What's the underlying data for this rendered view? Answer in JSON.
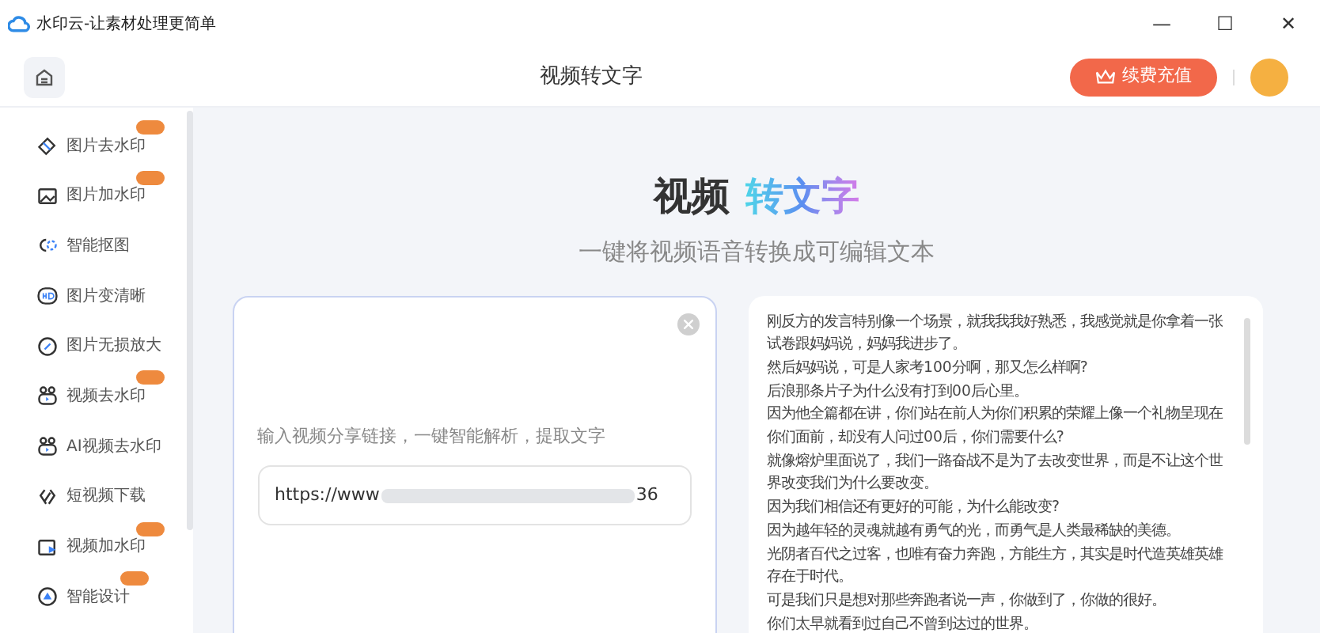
{
  "window": {
    "title": "水印云-让素材处理更简单",
    "controls": [
      "—",
      "☐",
      "✕"
    ]
  },
  "header": {
    "title": "视频转文字",
    "recharge": "续费充值"
  },
  "sidebar": {
    "items": [
      {
        "label": "图片去水印",
        "kind": "eraser",
        "badge": true
      },
      {
        "label": "图片加水印",
        "kind": "image",
        "badge": true
      },
      {
        "label": "智能抠图",
        "kind": "cutout",
        "badge": false
      },
      {
        "label": "图片变清晰",
        "kind": "hd",
        "badge": false
      },
      {
        "label": "图片无损放大",
        "kind": "zoom",
        "badge": false
      },
      {
        "label": "视频去水印",
        "kind": "video",
        "badge": true
      },
      {
        "label": "AI视频去水印",
        "kind": "video",
        "badge": false
      },
      {
        "label": "短视频下载",
        "kind": "link",
        "badge": false
      },
      {
        "label": "视频加水印",
        "kind": "play",
        "badge": true
      },
      {
        "label": "智能设计",
        "kind": "design",
        "badge": true
      }
    ]
  },
  "hero": {
    "title_plain": "视频",
    "title_gradient": "转文字",
    "subtitle": "一键将视频语音转换成可编辑文本"
  },
  "input_card": {
    "prompt": "输入视频分享链接，一键智能解析，提取文字",
    "url_start": "https://www",
    "url_end": "36"
  },
  "transcript": {
    "lines": [
      "刚反方的发言特别像一个场景，就我我我好熟悉，我感觉就是你拿着一张试卷跟妈妈说，妈妈我进步了。",
      "然后妈妈说，可是人家考100分啊，那又怎么样啊?",
      "后浪那条片子为什么没有打到00后心里。",
      "因为他全篇都在讲，你们站在前人为你们积累的荣耀上像一个礼物呈现在你们面前，却没有人问过00后，你们需要什么?",
      "就像熔炉里面说了，我们一路奋战不是为了去改变世界，而是不让这个世界改变我们为什么要改变。",
      "因为我们相信还有更好的可能，为什么能改变?",
      "因为越年轻的灵魂就越有勇气的光，而勇气是人类最稀缺的美德。",
      "光阴者百代之过客，也唯有奋力奔跑，方能生方，其实是时代造英雄英雄存在于时代。",
      "可是我们只是想对那些奔跑者说一声，你做到了，你做的很好。",
      "你们太早就看到过自己不曾到达过的世界。"
    ]
  }
}
